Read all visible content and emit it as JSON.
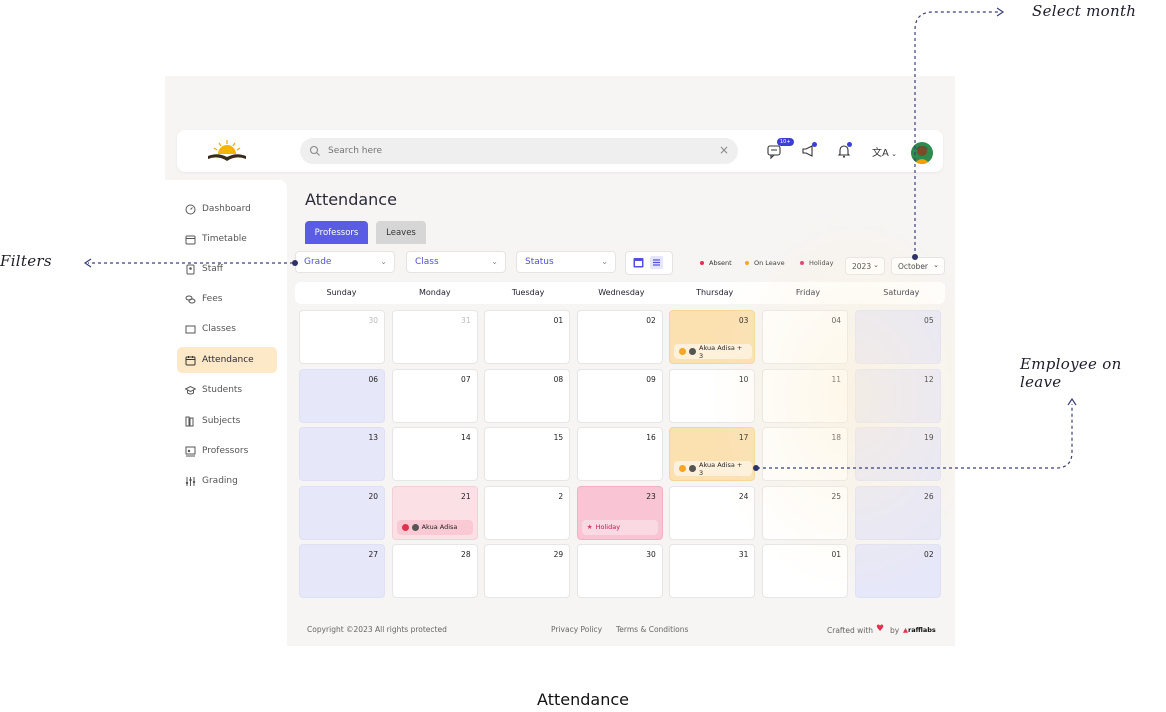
{
  "annotations": {
    "select_month": "Select month",
    "filters": "Filters",
    "employee_on_leave": "Employee on leave"
  },
  "caption": "Attendance",
  "header": {
    "search_placeholder": "Search here",
    "messages_badge": "10+",
    "language_icon": "translate-icon"
  },
  "sidebar": {
    "items": [
      {
        "label": "Dashboard",
        "icon": "dashboard-icon"
      },
      {
        "label": "Timetable",
        "icon": "calendar-clock-icon"
      },
      {
        "label": "Staff",
        "icon": "id-card-icon"
      },
      {
        "label": "Fees",
        "icon": "coins-icon"
      },
      {
        "label": "Classes",
        "icon": "board-icon"
      },
      {
        "label": "Attendance",
        "icon": "calendar-icon"
      },
      {
        "label": "Students",
        "icon": "graduation-cap-icon"
      },
      {
        "label": "Subjects",
        "icon": "books-icon"
      },
      {
        "label": "Professors",
        "icon": "teacher-icon"
      },
      {
        "label": "Grading",
        "icon": "sliders-icon"
      }
    ],
    "active": "Attendance"
  },
  "main": {
    "title": "Attendance",
    "tabs": [
      {
        "label": "Professors",
        "active": true
      },
      {
        "label": "Leaves",
        "active": false
      }
    ],
    "filters": {
      "grade": "Grade",
      "class": "Class",
      "status": "Status"
    },
    "legend": [
      {
        "label": "Absent",
        "color": "#e0314f"
      },
      {
        "label": "On Leave",
        "color": "#f5a623"
      },
      {
        "label": "Holiday",
        "color": "#d6336c"
      }
    ],
    "year": "2023",
    "month": "October"
  },
  "calendar": {
    "weekdays": [
      "Sunday",
      "Monday",
      "Tuesday",
      "Wednesday",
      "Thursday",
      "Friday",
      "Saturday"
    ],
    "weeks": [
      [
        {
          "day": "30",
          "type": "dim"
        },
        {
          "day": "31",
          "type": "dim"
        },
        {
          "day": "01",
          "type": "normal"
        },
        {
          "day": "02",
          "type": "normal"
        },
        {
          "day": "03",
          "type": "leave",
          "chip": "Akua Adisa + 3"
        },
        {
          "day": "04",
          "type": "normal"
        },
        {
          "day": "05",
          "type": "weekend"
        }
      ],
      [
        {
          "day": "06",
          "type": "weekend"
        },
        {
          "day": "07",
          "type": "normal"
        },
        {
          "day": "08",
          "type": "normal"
        },
        {
          "day": "09",
          "type": "normal"
        },
        {
          "day": "10",
          "type": "normal"
        },
        {
          "day": "11",
          "type": "normal"
        },
        {
          "day": "12",
          "type": "weekend"
        }
      ],
      [
        {
          "day": "13",
          "type": "weekend"
        },
        {
          "day": "14",
          "type": "normal"
        },
        {
          "day": "15",
          "type": "normal"
        },
        {
          "day": "16",
          "type": "normal"
        },
        {
          "day": "17",
          "type": "leave",
          "chip": "Akua Adisa + 3"
        },
        {
          "day": "18",
          "type": "normal"
        },
        {
          "day": "19",
          "type": "weekend"
        }
      ],
      [
        {
          "day": "20",
          "type": "weekend"
        },
        {
          "day": "21",
          "type": "absent",
          "chip": "Akua Adisa"
        },
        {
          "day": "2",
          "type": "normal"
        },
        {
          "day": "23",
          "type": "holiday",
          "chip": "Holiday"
        },
        {
          "day": "24",
          "type": "normal"
        },
        {
          "day": "25",
          "type": "normal"
        },
        {
          "day": "26",
          "type": "weekend"
        }
      ],
      [
        {
          "day": "27",
          "type": "weekend"
        },
        {
          "day": "28",
          "type": "normal"
        },
        {
          "day": "29",
          "type": "normal"
        },
        {
          "day": "30",
          "type": "normal"
        },
        {
          "day": "31",
          "type": "normal"
        },
        {
          "day": "01",
          "type": "normal"
        },
        {
          "day": "02",
          "type": "weekend"
        }
      ]
    ]
  },
  "footer": {
    "copyright": "Copyright ©2023 All rights protected",
    "privacy": "Privacy Policy",
    "terms": "Terms & Conditions",
    "crafted": "Crafted with",
    "by": "by",
    "brand": "rafflabs"
  }
}
